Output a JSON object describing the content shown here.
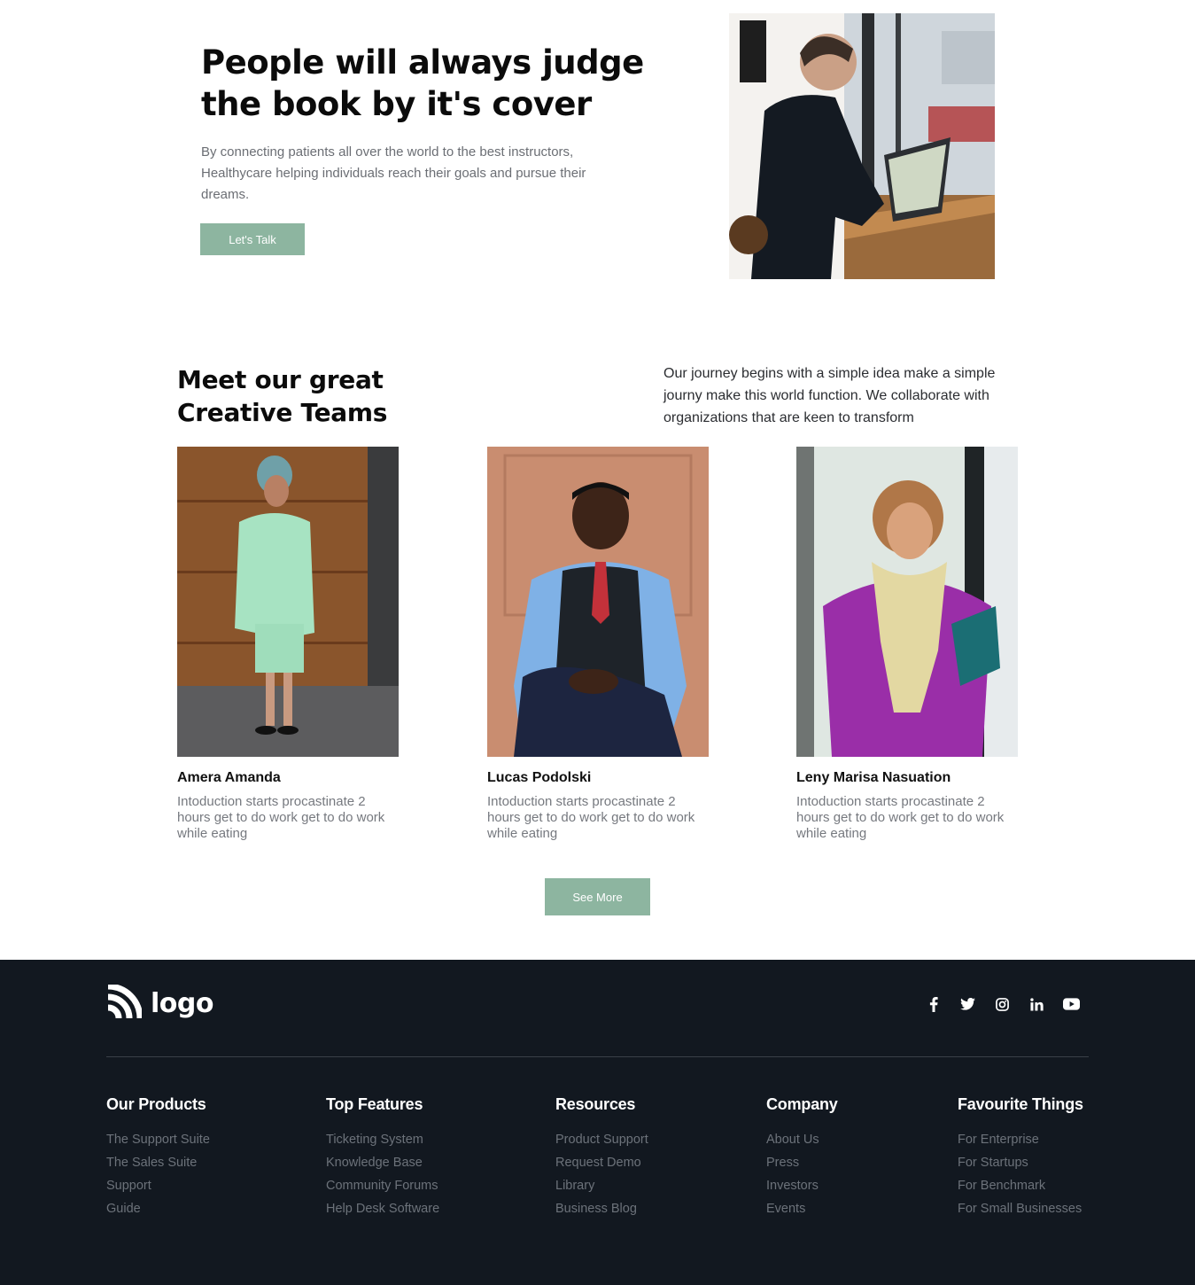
{
  "hero": {
    "title": "People will always judge the book by it's cover",
    "description": "By connecting patients all over the world to the best instructors, Healthycare helping individuals reach their goals and pursue their dreams.",
    "cta_label": "Let's Talk"
  },
  "team": {
    "title": "Meet our great Creative Teams",
    "description": "Our journey begins with a simple idea make a simple journy make this world function. We collaborate with organizations that are keen to transform",
    "members": [
      {
        "name": "Amera Amanda",
        "bio": "Intoduction starts procastinate 2 hours get to do work get to do work while eating"
      },
      {
        "name": "Lucas Podolski",
        "bio": "Intoduction starts procastinate 2 hours get to do work get to do work while eating"
      },
      {
        "name": "Leny Marisa Nasuation",
        "bio": "Intoduction starts procastinate 2 hours get to do work get to do work while eating"
      }
    ],
    "see_more_label": "See More"
  },
  "footer": {
    "logo_text": "logo",
    "socials": [
      "facebook-icon",
      "twitter-icon",
      "instagram-icon",
      "linkedin-icon",
      "youtube-icon"
    ],
    "columns": [
      {
        "heading": "Our Products",
        "links": [
          "The Support Suite",
          "The Sales Suite",
          "Support",
          "Guide"
        ]
      },
      {
        "heading": "Top Features",
        "links": [
          "Ticketing System",
          "Knowledge Base",
          "Community Forums",
          "Help Desk Software"
        ]
      },
      {
        "heading": "Resources",
        "links": [
          "Product Support",
          "Request Demo",
          "Library",
          "Business Blog"
        ]
      },
      {
        "heading": "Company",
        "links": [
          "About Us",
          "Press",
          "Investors",
          "Events"
        ]
      },
      {
        "heading": "Favourite Things",
        "links": [
          "For Enterprise",
          "For Startups",
          "For Benchmark",
          "For Small Businesses"
        ]
      }
    ]
  },
  "colors": {
    "accent": "#8db5a0",
    "footer_bg": "#121820",
    "muted_text": "#6c727a"
  }
}
